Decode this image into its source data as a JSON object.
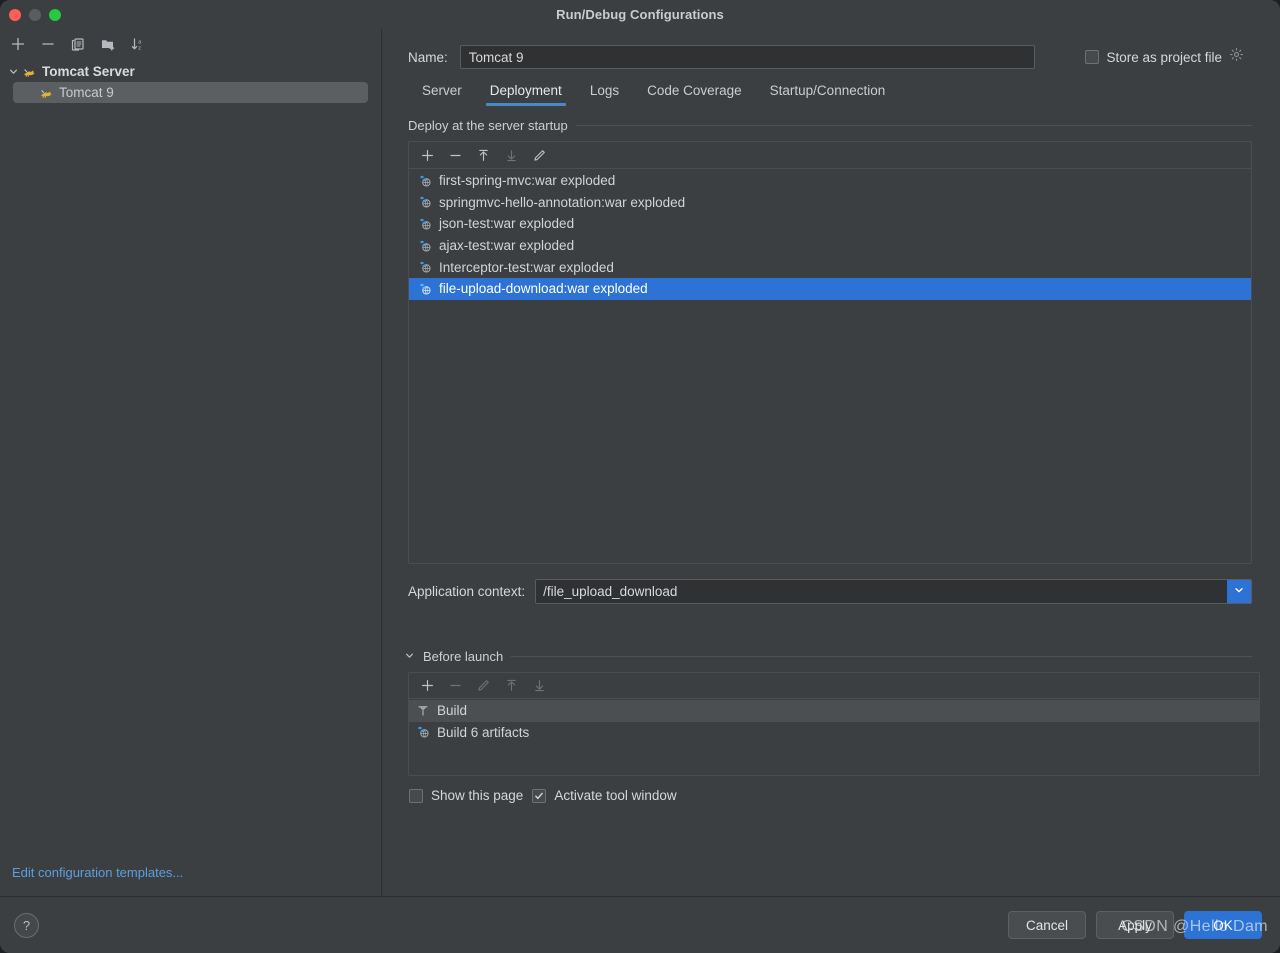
{
  "window": {
    "title": "Run/Debug Configurations",
    "traffic_lights": [
      "close",
      "minimize",
      "maximize"
    ]
  },
  "sidebar": {
    "toolbar": [
      {
        "name": "add-configuration-button",
        "icon": "plus-icon"
      },
      {
        "name": "remove-configuration-button",
        "icon": "minus-icon"
      },
      {
        "name": "copy-configuration-button",
        "icon": "copy-icon"
      },
      {
        "name": "new-folder-button",
        "icon": "folder-add-icon"
      },
      {
        "name": "sort-configurations-button",
        "icon": "sort-az-icon"
      }
    ],
    "tree": [
      {
        "label": "Tomcat Server",
        "type": "group",
        "expanded": true,
        "icon": "tomcat-icon"
      },
      {
        "label": "Tomcat 9",
        "type": "child",
        "selected": true,
        "icon": "tomcat-icon"
      }
    ],
    "edit_templates_link": "Edit configuration templates..."
  },
  "form": {
    "name_label": "Name:",
    "name_value": "Tomcat 9",
    "name_placeholder": "Name",
    "store_as_project_file_label": "Store as project file",
    "store_as_project_file_checked": false,
    "store_settings_icon": "gear-icon"
  },
  "tabs": [
    {
      "label": "Server",
      "active": false
    },
    {
      "label": "Deployment",
      "active": true
    },
    {
      "label": "Logs",
      "active": false
    },
    {
      "label": "Code Coverage",
      "active": false
    },
    {
      "label": "Startup/Connection",
      "active": false
    }
  ],
  "deployment": {
    "section_title": "Deploy at the server startup",
    "toolbar": [
      {
        "name": "add-artifact-button",
        "icon": "plus-icon",
        "enabled": true
      },
      {
        "name": "remove-artifact-button",
        "icon": "minus-icon",
        "enabled": true
      },
      {
        "name": "move-up-button",
        "icon": "arrow-up-icon",
        "enabled": true
      },
      {
        "name": "move-down-button",
        "icon": "arrow-down-icon",
        "enabled": false
      },
      {
        "name": "edit-artifact-button",
        "icon": "pencil-icon",
        "enabled": true
      }
    ],
    "items": [
      {
        "label": "first-spring-mvc:war exploded",
        "icon": "artifact-icon",
        "selected": false
      },
      {
        "label": "springmvc-hello-annotation:war exploded",
        "icon": "artifact-icon",
        "selected": false
      },
      {
        "label": "json-test:war exploded",
        "icon": "artifact-icon",
        "selected": false
      },
      {
        "label": "ajax-test:war exploded",
        "icon": "artifact-icon",
        "selected": false
      },
      {
        "label": "Interceptor-test:war exploded",
        "icon": "artifact-icon",
        "selected": false
      },
      {
        "label": "file-upload-download:war exploded",
        "icon": "artifact-icon",
        "selected": true
      }
    ]
  },
  "application_context": {
    "label": "Application context:",
    "value": "/file_upload_download",
    "placeholder": "/context",
    "dropdown_icon": "chevron-down-icon"
  },
  "before_launch": {
    "section_title": "Before launch",
    "expanded": true,
    "toolbar": [
      {
        "name": "add-task-button",
        "icon": "plus-icon",
        "enabled": true
      },
      {
        "name": "remove-task-button",
        "icon": "minus-icon",
        "enabled": false
      },
      {
        "name": "edit-task-button",
        "icon": "pencil-icon",
        "enabled": false
      },
      {
        "name": "move-task-up-button",
        "icon": "arrow-up-icon",
        "enabled": false
      },
      {
        "name": "move-task-down-button",
        "icon": "arrow-down-icon",
        "enabled": false
      }
    ],
    "tasks": [
      {
        "label": "Build",
        "icon": "build-hammer-icon",
        "selected": true
      },
      {
        "label": "Build 6 artifacts",
        "icon": "artifact-icon",
        "selected": false
      }
    ],
    "show_this_page_label": "Show this page",
    "show_this_page_checked": false,
    "activate_tool_window_label": "Activate tool window",
    "activate_tool_window_checked": true
  },
  "footer": {
    "help_label": "?",
    "cancel_label": "Cancel",
    "apply_label": "Apply",
    "ok_label": "OK"
  },
  "watermark": "CSDN @Hello Dam",
  "colors": {
    "dialog_bg": "#3c3f41",
    "accent_blue": "#2d73d5",
    "tab_underline": "#4a88c7",
    "link_blue": "#5c9ede",
    "text_primary": "#d7d9dd",
    "selection_gray": "#5c5f61",
    "tomcat_yellow": "#e0b03a"
  }
}
